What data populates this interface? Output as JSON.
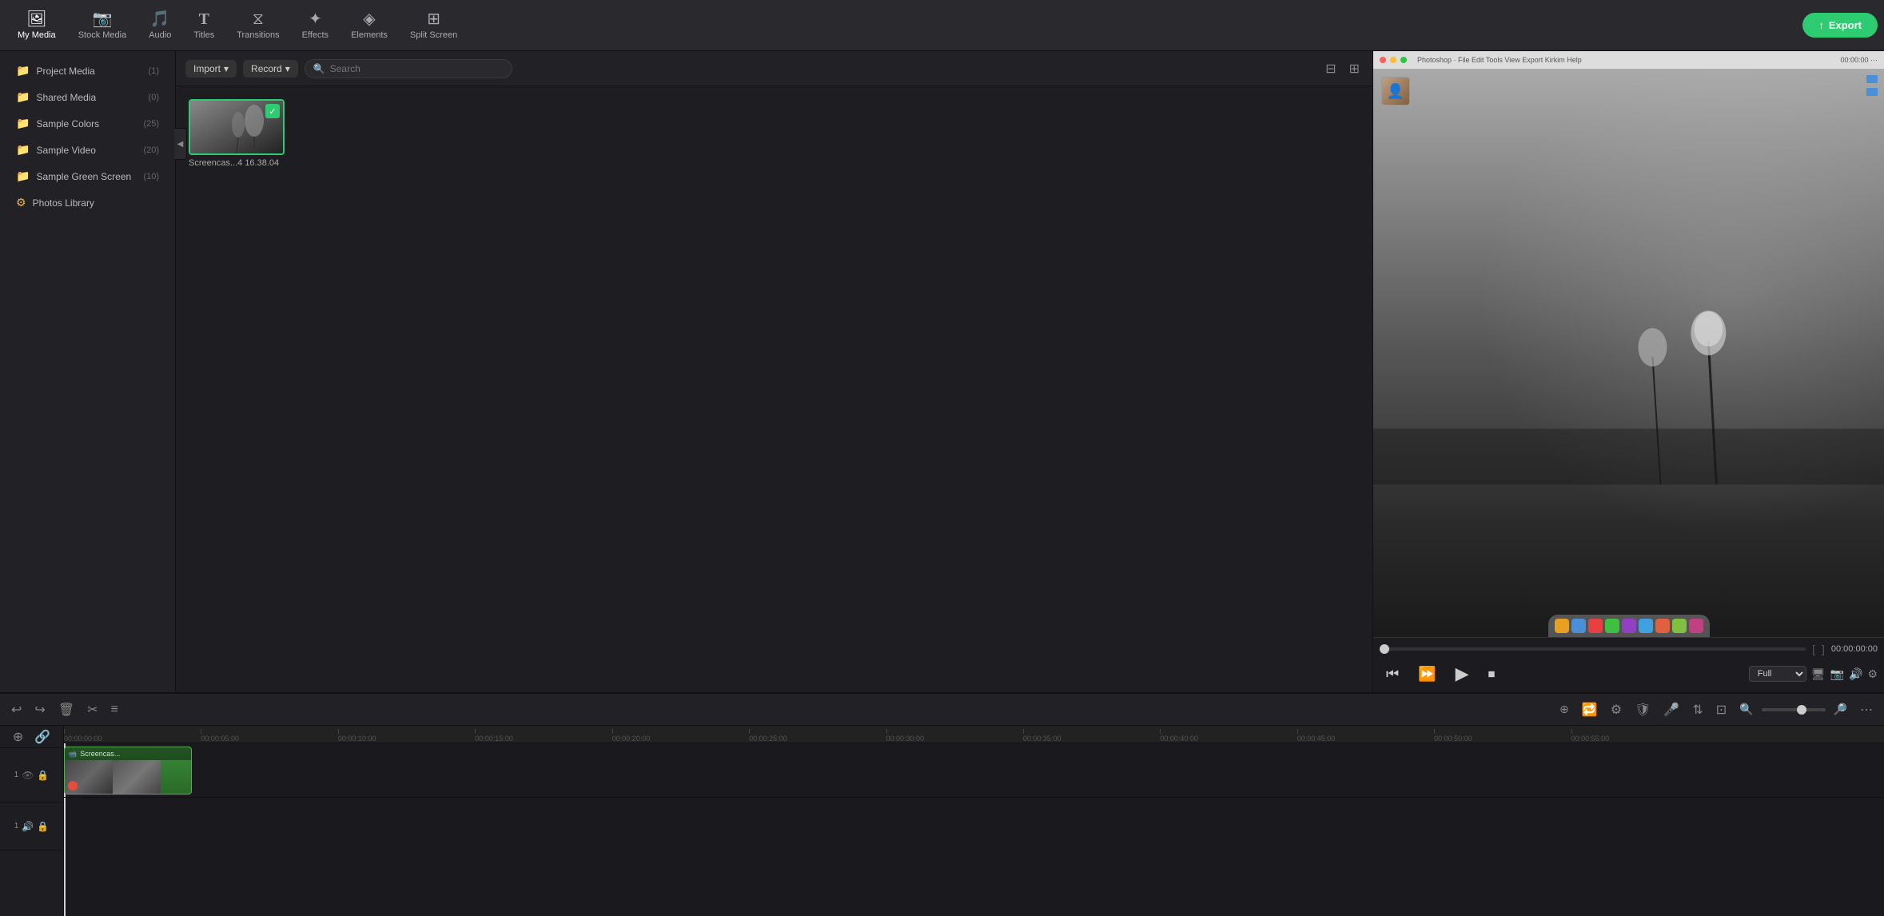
{
  "topNav": {
    "items": [
      {
        "id": "my-media",
        "label": "My Media",
        "icon": "🖼",
        "active": true
      },
      {
        "id": "stock-media",
        "label": "Stock Media",
        "icon": "📷",
        "active": false
      },
      {
        "id": "audio",
        "label": "Audio",
        "icon": "🎵",
        "active": false
      },
      {
        "id": "titles",
        "label": "Titles",
        "icon": "T",
        "active": false
      },
      {
        "id": "transitions",
        "label": "Transitions",
        "icon": "⧖",
        "active": false
      },
      {
        "id": "effects",
        "label": "Effects",
        "icon": "✦",
        "active": false
      },
      {
        "id": "elements",
        "label": "Elements",
        "icon": "◈",
        "active": false
      },
      {
        "id": "split-screen",
        "label": "Split Screen",
        "icon": "⊞",
        "active": false
      }
    ],
    "exportLabel": "Export"
  },
  "sidebar": {
    "items": [
      {
        "id": "project-media",
        "label": "Project Media",
        "count": "(1)",
        "icon": "📁"
      },
      {
        "id": "shared-media",
        "label": "Shared Media",
        "count": "(0)",
        "icon": "📁"
      },
      {
        "id": "sample-colors",
        "label": "Sample Colors",
        "count": "(25)",
        "icon": "📁"
      },
      {
        "id": "sample-video",
        "label": "Sample Video",
        "count": "(20)",
        "icon": "📁"
      },
      {
        "id": "sample-green-screen",
        "label": "Sample Green Screen",
        "count": "(10)",
        "icon": "📁"
      },
      {
        "id": "photos-library",
        "label": "Photos Library",
        "count": "",
        "icon": "⚙"
      }
    ]
  },
  "contentToolbar": {
    "importLabel": "Import",
    "recordLabel": "Record",
    "searchPlaceholder": "Search"
  },
  "mediaGrid": {
    "items": [
      {
        "id": "screencas-1",
        "label": "Screencas...4 16.38.04",
        "selected": true
      }
    ]
  },
  "preview": {
    "timeDisplay": "00:00:00:00",
    "quality": "Full",
    "controlIcons": [
      "⏮",
      "⏩",
      "▶",
      "⏹"
    ]
  },
  "timelineToolbar": {
    "buttons": [
      "↩",
      "↪",
      "🗑",
      "✂",
      "≡"
    ],
    "addButton": "+",
    "loopButton": "🔁",
    "zoomOutIcon": "🔍",
    "zoomInIcon": "🔍"
  },
  "timelineRuler": {
    "marks": [
      "00:00:00:00",
      "00:00:05:00",
      "00:00:10:00",
      "00:00:15:00",
      "00:00:20:00",
      "00:00:25:00",
      "00:00:30:00",
      "00:00:35:00",
      "00:00:40:00",
      "00:00:45:00",
      "00:00:50:00",
      "00:00:55:00"
    ]
  },
  "tracks": {
    "video": {
      "trackNum": "1",
      "eyeIcon": "👁",
      "lockIcon": "🔒",
      "clipName": "Screencas..."
    },
    "audio": {
      "trackNum": "1",
      "muteIcon": "🔊",
      "lockIcon": "🔒"
    }
  }
}
